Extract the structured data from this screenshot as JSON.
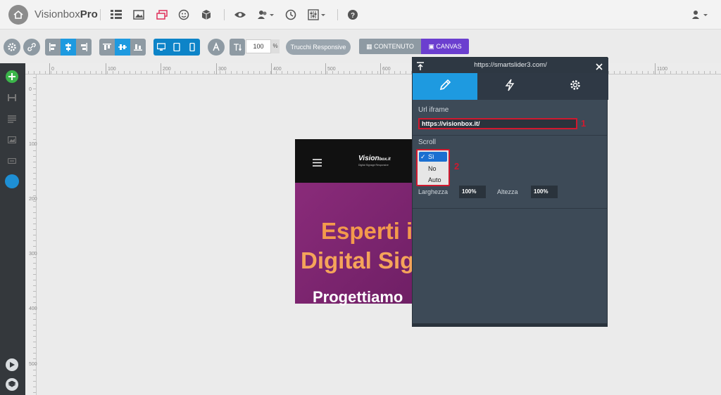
{
  "header": {
    "brand_light": "Visionbox",
    "brand_bold": "Pro",
    "icons": [
      "home-icon",
      "list-icon",
      "image-icon",
      "layers-icon",
      "smiley-icon",
      "cube-icon",
      "eye-icon",
      "users-icon",
      "clock-icon",
      "sliders-icon",
      "help-icon",
      "user-icon"
    ]
  },
  "toolbar": {
    "zoom_value": "100",
    "zoom_unit": "%",
    "responsive_label": "Trucchi Responsive",
    "contenuto_label": "CONTENUTO",
    "canvas_label": "CANVAS"
  },
  "ruler": {
    "top_labels": [
      "0",
      "100",
      "200",
      "300",
      "400",
      "500",
      "600",
      "1100"
    ],
    "left_labels": [
      "0",
      "100",
      "200",
      "300",
      "400",
      "500"
    ]
  },
  "stage": {
    "logo_text": "Vision",
    "logo_suffix": "box.it",
    "logo_tagline": "Digital Signage Responsive",
    "headline_1": "Esperti i",
    "headline_2": "Digital Sig",
    "headline_3": "Progettiamo"
  },
  "panel": {
    "title": "https://smartslider3.com/",
    "url_label": "Url iframe",
    "url_value": "https://visionbox.it/",
    "badge_1": "1",
    "scroll_label": "Scroll",
    "scroll_options": [
      "Sì",
      "No",
      "Auto"
    ],
    "scroll_selected": "Sì",
    "badge_2": "2",
    "width_label": "Larghezza",
    "width_value": "100%",
    "height_label": "Altezza",
    "height_value": "100%"
  },
  "colors": {
    "accent_blue": "#1e9ae0",
    "canvas_purple": "#6b3fcf",
    "annotation_red": "#d0192f",
    "panel_bg": "#3d4a57"
  }
}
